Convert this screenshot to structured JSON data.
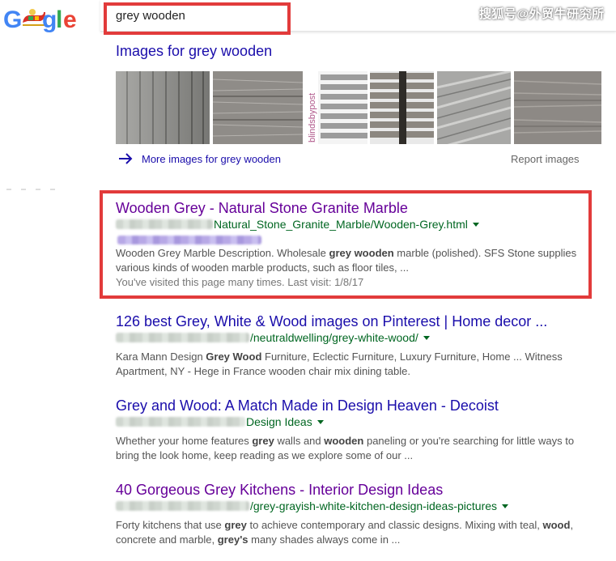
{
  "header": {
    "logo_letters": [
      "G",
      "o",
      "o",
      "g",
      "l",
      "e"
    ],
    "search_value": "grey wooden",
    "watermark": "搜狐号@外贸牛研究所"
  },
  "images": {
    "heading": "Images for grey wooden",
    "thumb_watermark": "blindsbypost",
    "more_label": "More images for grey wooden",
    "report_label": "Report images"
  },
  "results": [
    {
      "title": "Wooden Grey - Natural Stone Granite Marble",
      "url_tail": "Natural_Stone_Granite_Marble/Wooden-Grey.html",
      "snippet_html_parts": [
        "Wooden Grey Marble Description. Wholesale ",
        "grey wooden",
        " marble (polished). SFS Stone supplies various kinds of wooden marble products, such as floor tiles, ..."
      ],
      "visited": "You've visited this page many times. Last visit: 1/8/17"
    },
    {
      "title": "126 best Grey, White & Wood images on Pinterest | Home decor ...",
      "url_tail": "/neutraldwelling/grey-white-wood/",
      "snippet_parts": [
        "Kara Mann Design ",
        "Grey Wood",
        " Furniture, Eclectic Furniture, Luxury Furniture, Home ... Witness Apartment, NY - Hege in France wooden chair mix dining table."
      ]
    },
    {
      "title": "Grey and Wood: A Match Made in Design Heaven - Decoist",
      "url_tail": "Design Ideas",
      "snippet_parts": [
        "Whether your home features ",
        "grey",
        " walls and ",
        "wooden",
        " paneling or you're searching for little ways to bring the look home, keep reading as we explore some of our ..."
      ]
    },
    {
      "title": "40 Gorgeous Grey Kitchens - Interior Design Ideas",
      "url_tail": "/grey-grayish-white-kitchen-design-ideas-pictures",
      "snippet_parts": [
        "Forty kitchens that use ",
        "grey",
        " to achieve contemporary and classic designs. Mixing with teal, ",
        "wood",
        ", concrete and marble, ",
        "grey's",
        " many shades always come in ..."
      ]
    }
  ],
  "colors": {
    "link": "#1a0dab",
    "visited": "#660099",
    "url_green": "#006621",
    "highlight_red": "#e23b3b"
  }
}
